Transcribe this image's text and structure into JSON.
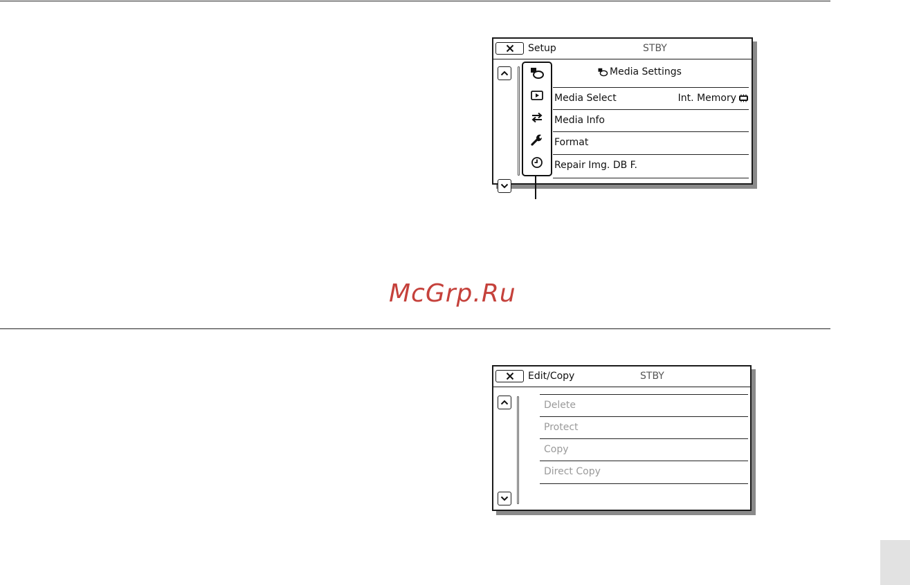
{
  "watermark": {
    "text": "McGrp.Ru"
  },
  "setup_screen": {
    "title": "Setup",
    "status": "STBY",
    "section_heading": "Media Settings",
    "categories": [
      {
        "icon": "media-settings-icon"
      },
      {
        "icon": "playback-settings-icon"
      },
      {
        "icon": "connection-icon"
      },
      {
        "icon": "general-settings-icon"
      },
      {
        "icon": "clock-icon"
      }
    ],
    "items": [
      {
        "label": "Media Select",
        "value": "Int. Memory",
        "value_icon": "internal-memory-icon"
      },
      {
        "label": "Media Info"
      },
      {
        "label": "Format"
      },
      {
        "label": "Repair Img. DB F."
      }
    ]
  },
  "edit_screen": {
    "title": "Edit/Copy",
    "status": "STBY",
    "items": [
      {
        "label": "Delete",
        "enabled": false
      },
      {
        "label": "Protect",
        "enabled": false
      },
      {
        "label": "Copy",
        "enabled": false
      },
      {
        "label": "Direct Copy",
        "enabled": false
      }
    ]
  },
  "colors": {
    "watermark": "#c5413b",
    "disabled_text": "#9a9a9a",
    "frame": "#1a1a1a",
    "shadow": "#8a8a8a"
  }
}
